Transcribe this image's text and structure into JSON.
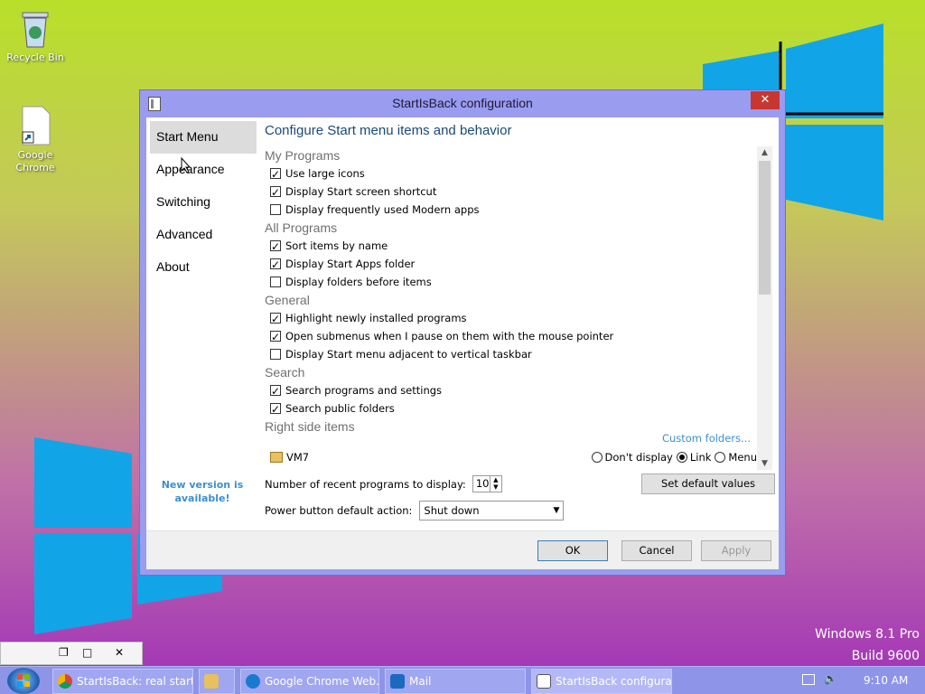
{
  "desktop": {
    "icons": [
      {
        "label": "Recycle Bin"
      },
      {
        "label": "Google Chrome"
      }
    ],
    "watermark": {
      "edition": "Windows 8.1 Pro",
      "build": "Build 9600"
    }
  },
  "dialog": {
    "title": "StartIsBack configuration",
    "close_glyph": "✕",
    "nav": {
      "items": [
        {
          "label": "Start Menu",
          "selected": true
        },
        {
          "label": "Appearance",
          "selected": false
        },
        {
          "label": "Switching",
          "selected": false
        },
        {
          "label": "Advanced",
          "selected": false
        },
        {
          "label": "About",
          "selected": false
        }
      ],
      "new_version": "New version is available!"
    },
    "heading": "Configure Start menu items and behavior",
    "sections": [
      {
        "title": "My Programs",
        "options": [
          {
            "label": "Use large icons",
            "checked": true
          },
          {
            "label": "Display Start screen shortcut",
            "checked": true
          },
          {
            "label": "Display frequently used Modern apps",
            "checked": false
          }
        ]
      },
      {
        "title": "All Programs",
        "options": [
          {
            "label": "Sort items by name",
            "checked": true
          },
          {
            "label": "Display Start Apps folder",
            "checked": true
          },
          {
            "label": "Display folders before items",
            "checked": false
          }
        ]
      },
      {
        "title": "General",
        "options": [
          {
            "label": "Highlight newly installed programs",
            "checked": true
          },
          {
            "label": "Open submenus when I pause on them with the mouse pointer",
            "checked": true
          },
          {
            "label": "Display Start menu adjacent to vertical taskbar",
            "checked": false
          }
        ]
      },
      {
        "title": "Search",
        "options": [
          {
            "label": "Search programs and settings",
            "checked": true
          },
          {
            "label": "Search public folders",
            "checked": true
          }
        ]
      }
    ],
    "right_side": {
      "title": "Right side items",
      "custom_folders": "Custom folders...",
      "item_label": "VM7",
      "radio_options": [
        {
          "label": "Don't display",
          "checked": false
        },
        {
          "label": "Link",
          "checked": true
        },
        {
          "label": "Menu",
          "checked": false
        }
      ]
    },
    "recent_label": "Number of recent programs to display:",
    "recent_value": "10",
    "set_default": "Set default values",
    "power_label": "Power button default action:",
    "power_value": "Shut down",
    "buttons": {
      "ok": "OK",
      "cancel": "Cancel",
      "apply": "Apply"
    }
  },
  "taskbar": {
    "tasks": [
      {
        "label": "StartIsBack: real start ...",
        "icon": "chrome-icon"
      },
      {
        "label": "",
        "icon": "file-explorer-icon"
      },
      {
        "label": "Google Chrome Web...",
        "icon": "ie-icon"
      },
      {
        "label": "Mail",
        "icon": "mail-icon"
      },
      {
        "label": "StartIsBack configura...",
        "icon": "startisback-icon"
      }
    ],
    "clock": "9:10 AM"
  },
  "colors": {
    "accent": "#9a9cf0",
    "link": "#3d8fd0",
    "close": "#c7372f"
  }
}
